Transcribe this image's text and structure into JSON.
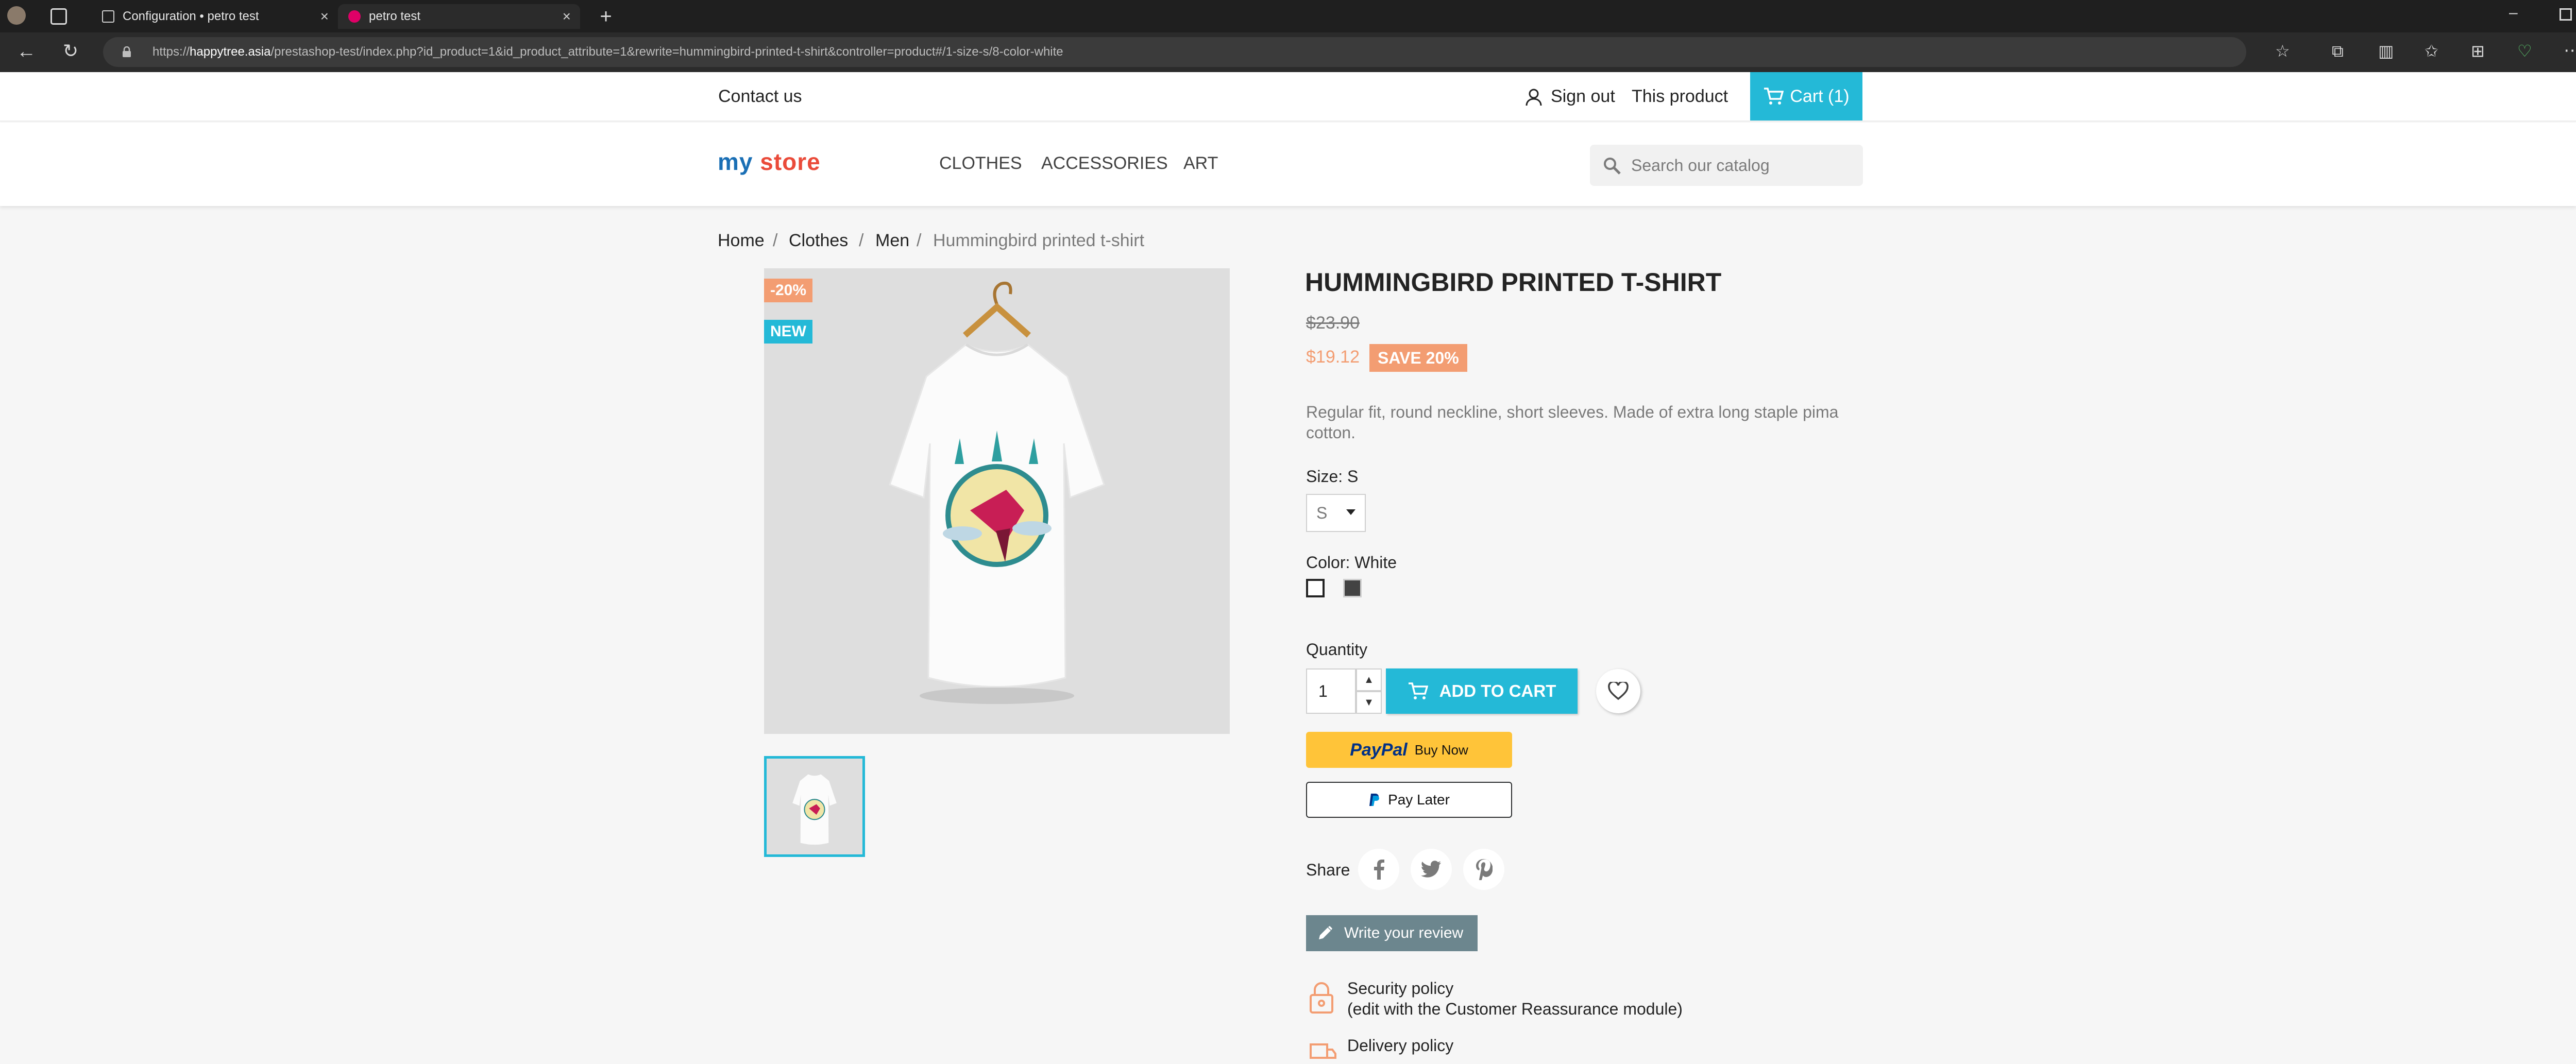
{
  "browser": {
    "tabs": [
      {
        "title": "Configuration • petro test",
        "active": false
      },
      {
        "title": "petro test",
        "active": true
      }
    ],
    "url_prefix": "https://",
    "url_host": "happytree.asia",
    "url_path": "/prestashop-test/index.php?id_product=1&id_product_attribute=1&rewrite=hummingbird-printed-t-shirt&controller=product#/1-size-s/8-color-white"
  },
  "header": {
    "contact": "Contact us",
    "sign_out": "Sign out",
    "this_product": "This product",
    "cart": "Cart (1)",
    "logo_my": "my",
    "logo_store": "store",
    "menu": [
      "CLOTHES",
      "ACCESSORIES",
      "ART"
    ],
    "search_placeholder": "Search our catalog"
  },
  "breadcrumb": [
    "Home",
    "Clothes",
    "Men",
    "Hummingbird printed t-shirt"
  ],
  "product": {
    "discount_flag": "-20%",
    "new_flag": "NEW",
    "title": "HUMMINGBIRD PRINTED T-SHIRT",
    "regular_price": "$23.90",
    "price": "$19.12",
    "save_badge": "SAVE 20%",
    "description": "Regular fit, round neckline, short sleeves. Made of extra long staple pima cotton.",
    "size_label": "Size: S",
    "size_value": "S",
    "color_label": "Color: White",
    "colors": [
      {
        "name": "White",
        "hex": "#ffffff",
        "selected": true
      },
      {
        "name": "Black",
        "hex": "#434343",
        "selected": false
      }
    ],
    "quantity_label": "Quantity",
    "quantity": "1",
    "add_to_cart": "ADD TO CART",
    "paypal_brand": "PayPal",
    "paypal_buy": "Buy Now",
    "pay_later": "Pay Later",
    "share_label": "Share",
    "write_review": "Write your review"
  },
  "reassurance": [
    {
      "title": "Security policy",
      "subtitle": "(edit with the Customer Reassurance module)"
    },
    {
      "title": "Delivery policy"
    }
  ],
  "colors": {
    "accent": "#24b9d7",
    "sale": "#f39d72",
    "review_button": "#6c868e",
    "paypal_yellow": "#ffc439",
    "paypal_blue": "#003087"
  }
}
